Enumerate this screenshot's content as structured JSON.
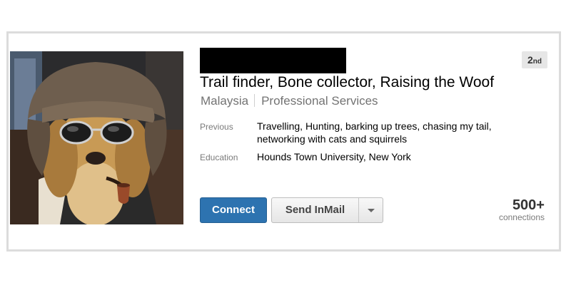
{
  "profile": {
    "degree": "2",
    "degree_suffix": "nd",
    "headline": "Trail finder, Bone collector, Raising the Woof",
    "location": "Malaysia",
    "industry": "Professional Services",
    "previous_label": "Previous",
    "previous_line1": "Travelling, Hunting, barking up trees, chasing my tail,",
    "previous_line2": "networking with cats and squirrels",
    "education_label": "Education",
    "education_value": "Hounds Town University, New York"
  },
  "actions": {
    "connect_label": "Connect",
    "inmail_label": "Send InMail",
    "more_icon": "chevron-down-icon"
  },
  "connections": {
    "count": "500+",
    "label": "connections"
  },
  "colors": {
    "primary_button": "#2d73b0",
    "card_border": "#dcdcdc",
    "muted_text": "#737373"
  }
}
